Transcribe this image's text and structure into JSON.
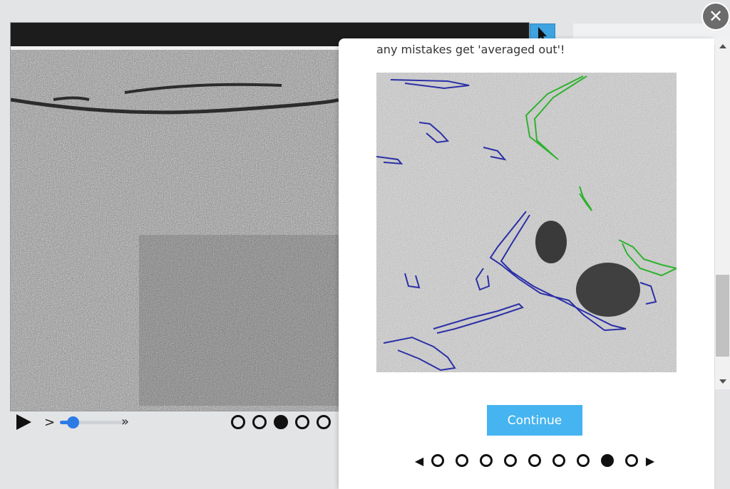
{
  "toolbar": {
    "pointer_icon": "cursor-arrow-icon"
  },
  "playback": {
    "play_icon": "play-icon",
    "slow_symbol": ">",
    "fast_symbol": "»",
    "speed_level": 0.2,
    "frames": 5,
    "active_frame": 3
  },
  "modal": {
    "text": "any mistakes get 'averaged out'!",
    "continue_label": "Continue",
    "close_symbol": "✕",
    "prev_symbol": "◀",
    "next_symbol": "▶",
    "pages": 9,
    "active_page": 8,
    "annotation_colors": {
      "blue": "#2b2fa6",
      "green": "#2eb22e"
    }
  },
  "colors": {
    "accent": "#46b4f0",
    "slider": "#2c7be5"
  }
}
